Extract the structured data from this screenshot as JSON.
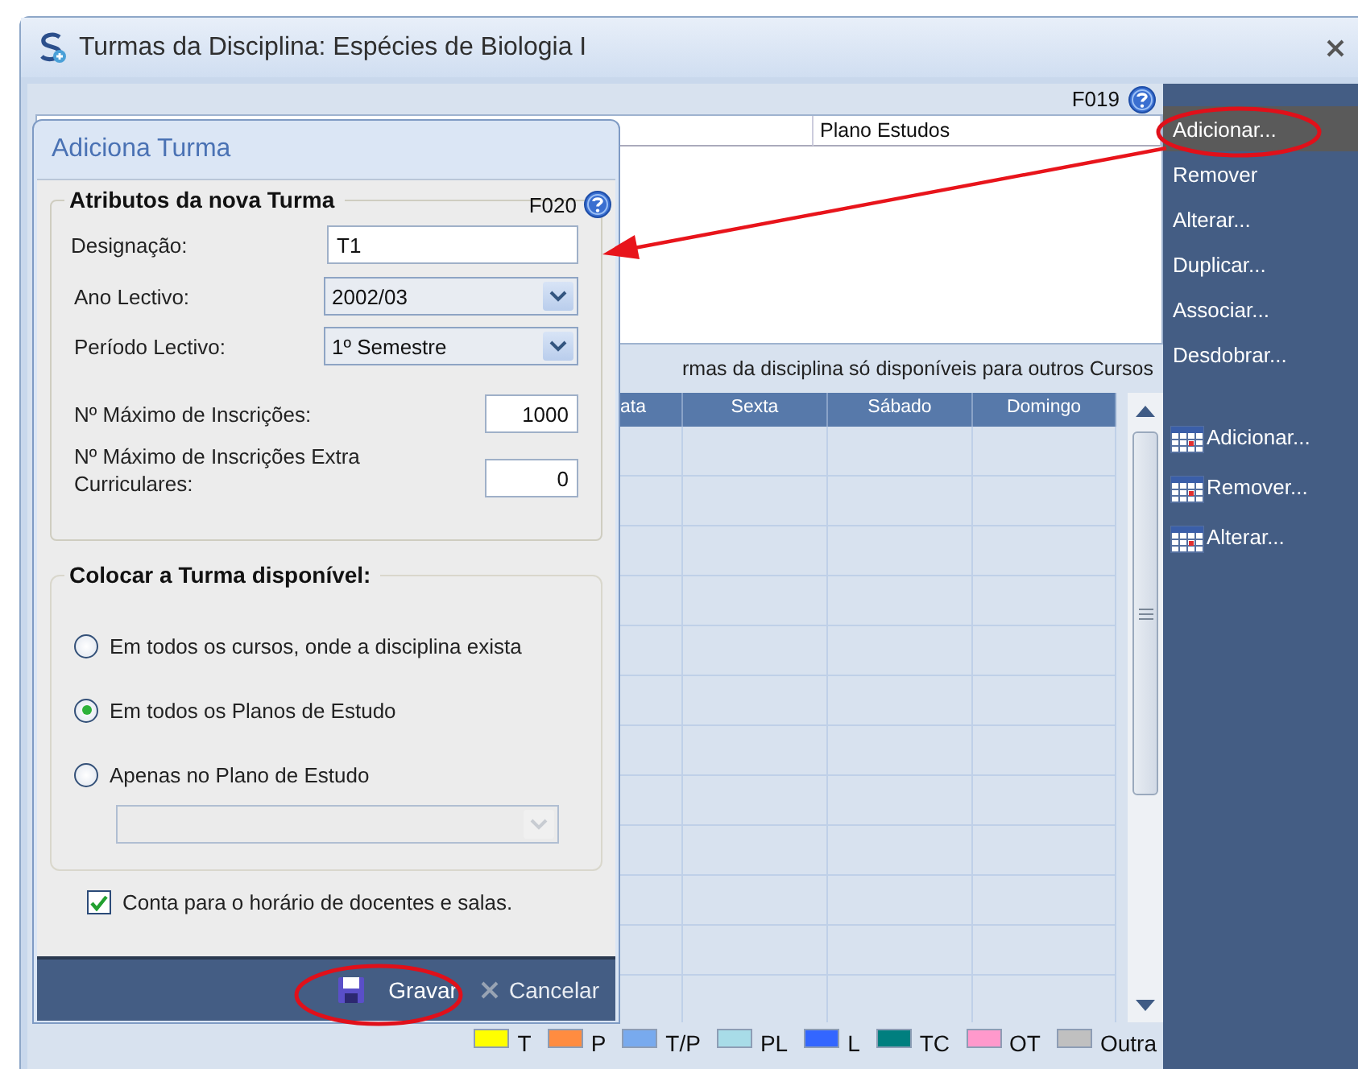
{
  "window": {
    "title": "Turmas da Disciplina: Espécies de Biologia I"
  },
  "main": {
    "form_code": "F019",
    "top_table": {
      "columns": [
        "Plano Estudos"
      ]
    },
    "caption": "rmas da disciplina só disponíveis para outros Cursos",
    "schedule": {
      "columns": [
        "ata",
        "Sexta",
        "Sábado",
        "Domingo"
      ]
    },
    "legend": [
      {
        "label": "T",
        "color": "#ffff00"
      },
      {
        "label": "P",
        "color": "#ff8c40"
      },
      {
        "label": "T/P",
        "color": "#78aaee"
      },
      {
        "label": "PL",
        "color": "#a8dce8"
      },
      {
        "label": "L",
        "color": "#3366ff"
      },
      {
        "label": "TC",
        "color": "#007f7f"
      },
      {
        "label": "OT",
        "color": "#ff99cc"
      },
      {
        "label": "Outra",
        "color": "#c0c0c0"
      }
    ]
  },
  "sidebar": {
    "items": [
      {
        "label": "Adicionar...",
        "kind": "text",
        "selected": true
      },
      {
        "label": "Remover",
        "kind": "text",
        "selected": false
      },
      {
        "label": "Alterar...",
        "kind": "text",
        "selected": false
      },
      {
        "label": "Duplicar...",
        "kind": "text",
        "selected": false
      },
      {
        "label": "Associar...",
        "kind": "text",
        "selected": false
      },
      {
        "label": "Desdobrar...",
        "kind": "text",
        "selected": false
      },
      {
        "label": "Adicionar...",
        "kind": "calendar",
        "selected": false
      },
      {
        "label": "Remover...",
        "kind": "calendar",
        "selected": false
      },
      {
        "label": "Alterar...",
        "kind": "calendar",
        "selected": false
      }
    ]
  },
  "dialog": {
    "title": "Adiciona Turma",
    "form_code": "F020",
    "attributes": {
      "title": "Atributos da nova Turma",
      "fields": [
        {
          "kind": "text",
          "label": "Designação:",
          "value": "T1"
        },
        {
          "kind": "select",
          "label": "Ano Lectivo:",
          "value": "2002/03"
        },
        {
          "kind": "select",
          "label": "Período Lectivo:",
          "value": "1º Semestre"
        },
        {
          "kind": "number",
          "label": "Nº Máximo de Inscrições:",
          "value": "1000"
        },
        {
          "kind": "number",
          "label": "Nº Máximo de Inscrições Extra Curriculares:",
          "value": "0"
        }
      ]
    },
    "availability": {
      "title": "Colocar a Turma disponível:",
      "options": [
        {
          "label": "Em todos os cursos, onde a disciplina exista",
          "selected": false
        },
        {
          "label": "Em todos os Planos de Estudo",
          "selected": true
        },
        {
          "label": "Apenas no Plano de Estudo",
          "selected": false
        }
      ],
      "plan_select": {
        "disabled": true
      }
    },
    "checkbox": {
      "label": "Conta para o horário de docentes e salas.",
      "checked": true
    },
    "buttons": [
      {
        "kind": "save",
        "label": "Gravar"
      },
      {
        "kind": "cancel",
        "label": "Cancelar"
      }
    ]
  }
}
